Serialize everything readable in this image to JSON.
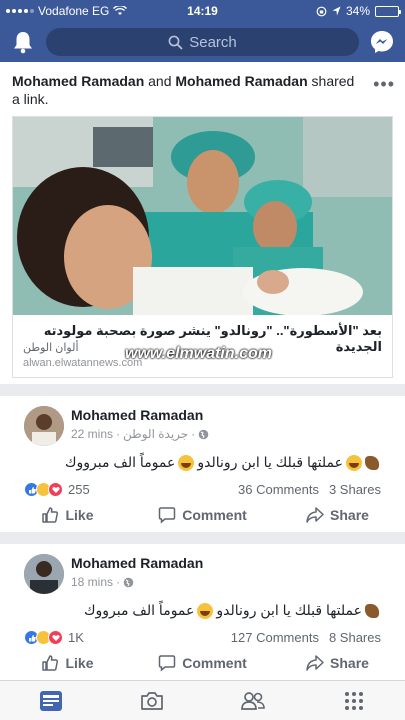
{
  "status_bar": {
    "carrier": "Vodafone EG",
    "time": "14:19",
    "battery": "34%",
    "battery_level": 0.34
  },
  "search": {
    "placeholder": "Search"
  },
  "shared_post": {
    "actor1": "Mohamed Ramadan",
    "connector": "and",
    "actor2": "Mohamed Ramadan",
    "action": "shared a link.",
    "more_icon": "more-dots-icon",
    "link": {
      "title": "بعد \"الأسطورة\".. \"رونالدو\" ينشر صورة بصحبة مولودته الجديدة",
      "source": "ألوان الوطن",
      "url": "alwan.elwatannews.com",
      "watermark": "www.elmwatin.com"
    }
  },
  "posts": [
    {
      "author": "Mohamed Ramadan",
      "time": "22 mins",
      "page": "جريدة الوطن",
      "text_part1": "عملتها قبلك يا ابن رونالدو",
      "text_part2": "عموماً الف مبرووك",
      "reactions_count": "255",
      "comments": "36 Comments",
      "shares": "3 Shares"
    },
    {
      "author": "Mohamed Ramadan",
      "time": "18 mins",
      "page": "",
      "text_part1": "عملتها قبلك يا ابن رونالدو",
      "text_part2": "عموماً الف مبرووك",
      "reactions_count": "1K",
      "comments": "127 Comments",
      "shares": "8 Shares"
    }
  ],
  "actions": {
    "like": "Like",
    "comment": "Comment",
    "share": "Share"
  },
  "colors": {
    "brand": "#3b5998",
    "like": "#3578e5",
    "love": "#f33e58",
    "haha": "#f7c23b"
  },
  "tabs": [
    "news-feed-icon",
    "camera-icon",
    "friends-icon",
    "menu-grid-icon"
  ]
}
